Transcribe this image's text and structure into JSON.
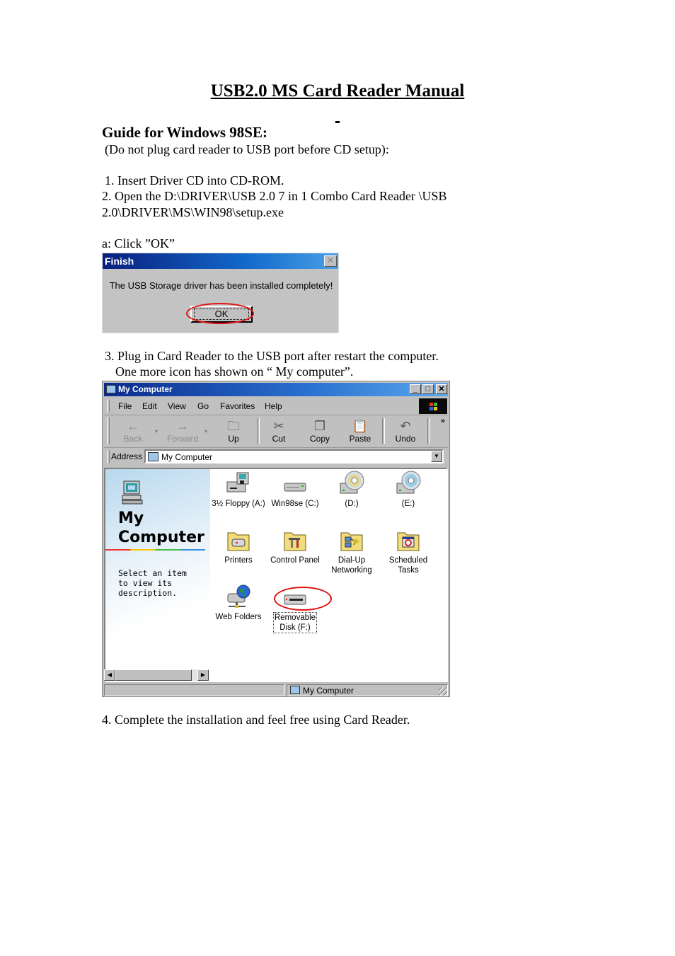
{
  "document": {
    "title": "USB2.0 MS Card Reader Manual",
    "section_heading": "Guide for Windows 98SE:",
    "note": "(Do not plug card reader to USB port before CD setup):",
    "steps": [
      "1. Insert Driver CD into CD-ROM.",
      "2. Open the D:\\DRIVER\\USB 2.0 7 in 1 Combo Card Reader \\USB",
      "2.0\\DRIVER\\MS\\WIN98\\setup.exe",
      "a: Click ”OK”",
      "3. Plug in Card Reader to the USB port after restart the computer.",
      "One more icon has shown on “ My computer”.",
      "4. Complete the installation and feel free using Card Reader."
    ]
  },
  "finish_dialog": {
    "title": "Finish",
    "close_glyph": "✕",
    "message": "The USB Storage driver has been installed completely!",
    "ok_label": "OK",
    "highlight_color": "#e01010"
  },
  "explorer": {
    "title": "My Computer",
    "window_buttons": {
      "minimize": "_",
      "maximize": "□",
      "close": "✕"
    },
    "menu": [
      "File",
      "Edit",
      "View",
      "Go",
      "Favorites",
      "Help"
    ],
    "toolbar": {
      "back": "Back",
      "forward": "Forward",
      "up": "Up",
      "cut": "Cut",
      "copy": "Copy",
      "paste": "Paste",
      "undo": "Undo",
      "more": "»"
    },
    "address_label": "Address",
    "address_value": "My Computer",
    "sidebar": {
      "heading_line1": "My",
      "heading_line2": "Computer",
      "description": "Select an item\nto view its\ndescription."
    },
    "items": [
      {
        "label": "3½ Floppy (A:)",
        "icon": "floppy-drive-icon"
      },
      {
        "label": "Win98se (C:)",
        "icon": "hard-drive-icon"
      },
      {
        "label": "(D:)",
        "icon": "cd-drive-icon"
      },
      {
        "label": "(E:)",
        "icon": "cd-drive-icon"
      },
      {
        "label": "Printers",
        "icon": "printers-folder-icon"
      },
      {
        "label": "Control Panel",
        "icon": "control-panel-folder-icon"
      },
      {
        "label": "Dial-Up Networking",
        "icon": "dialup-folder-icon"
      },
      {
        "label": "Scheduled Tasks",
        "icon": "scheduled-tasks-folder-icon"
      },
      {
        "label": "Web Folders",
        "icon": "web-folders-icon"
      },
      {
        "label": "Removable Disk (F:)",
        "icon": "removable-disk-icon"
      }
    ],
    "status_text": "My Computer",
    "highlight_color": "#e01010"
  }
}
